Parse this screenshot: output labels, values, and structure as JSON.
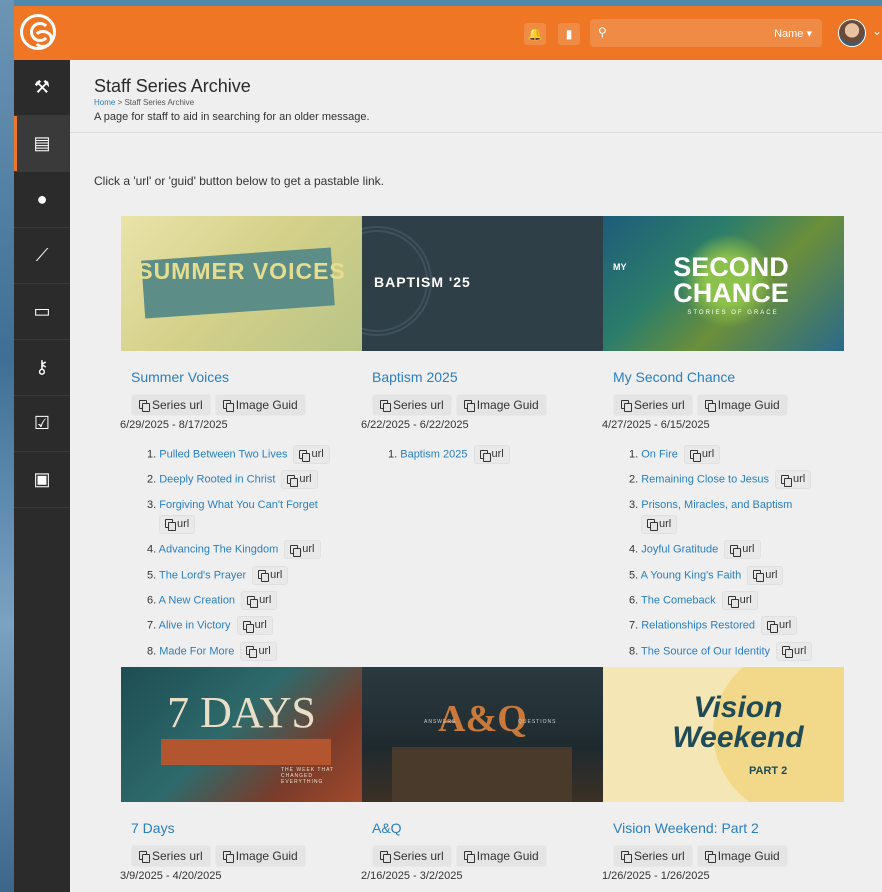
{
  "topbar": {
    "search_placeholder": "",
    "name_label": "Name ▾",
    "avatar_chevron": "⌄"
  },
  "sidebar": {
    "items": [
      {
        "icon": "gavel-icon",
        "glyph": "⚒"
      },
      {
        "icon": "book-icon",
        "glyph": "▤"
      },
      {
        "icon": "person-icon",
        "glyph": "●"
      },
      {
        "icon": "chart-icon",
        "glyph": "⟋"
      },
      {
        "icon": "money-icon",
        "glyph": "▭"
      },
      {
        "icon": "wrench-icon",
        "glyph": "⚷"
      },
      {
        "icon": "checkbox-icon",
        "glyph": "☑"
      },
      {
        "icon": "briefcase-icon",
        "glyph": "▣"
      }
    ]
  },
  "page": {
    "title": "Staff Series Archive",
    "breadcrumb_home": "Home",
    "breadcrumb_sep": " > ",
    "breadcrumb_current": "Staff Series Archive",
    "subtitle": "A page for staff to aid in searching for an older message.",
    "instruction": "Click a 'url' or 'guid' button below to get a pastable link."
  },
  "buttons": {
    "series_url": "Series url",
    "image_guid": "Image Guid",
    "url": "url"
  },
  "series": [
    {
      "title": "Summer Voices",
      "dates": "6/29/2025 - 8/17/2025",
      "image_text": "SUMMER VOICES",
      "messages": [
        "Pulled Between Two Lives",
        "Deeply Rooted in Christ",
        "Forgiving What You Can't Forget",
        "Advancing The Kingdom",
        "The Lord's Prayer",
        "A New Creation",
        "Alive in Victory",
        "Made For More"
      ]
    },
    {
      "title": "Baptism 2025",
      "dates": "6/22/2025 - 6/22/2025",
      "image_text": "BAPTISM '25",
      "messages": [
        "Baptism 2025"
      ]
    },
    {
      "title": "My Second Chance",
      "dates": "4/27/2025 - 6/15/2025",
      "image_text": "SECOND CHANCE",
      "image_small": "MY",
      "image_caption": "STORIES OF GRACE",
      "messages": [
        "On Fire",
        "Remaining Close to Jesus",
        "Prisons, Miracles, and Baptism",
        "Joyful Gratitude",
        "A Young King's Faith",
        "The Comeback",
        "Relationships Restored",
        "The Source of Our Identity"
      ]
    },
    {
      "title": "7 Days",
      "dates": "3/9/2025 - 4/20/2025",
      "image_text": "7 DAYS",
      "image_caption": "THE WEEK THAT CHANGED EVERYTHING",
      "messages": []
    },
    {
      "title": "A&Q",
      "dates": "2/16/2025 - 3/2/2025",
      "image_text": "A&Q",
      "image_left": "ANSWERS",
      "image_right": "QUESTIONS",
      "messages": []
    },
    {
      "title": "Vision Weekend: Part 2",
      "dates": "1/26/2025 - 1/26/2025",
      "image_text": "Vision Weekend",
      "image_caption": "PART 2",
      "messages": []
    }
  ]
}
